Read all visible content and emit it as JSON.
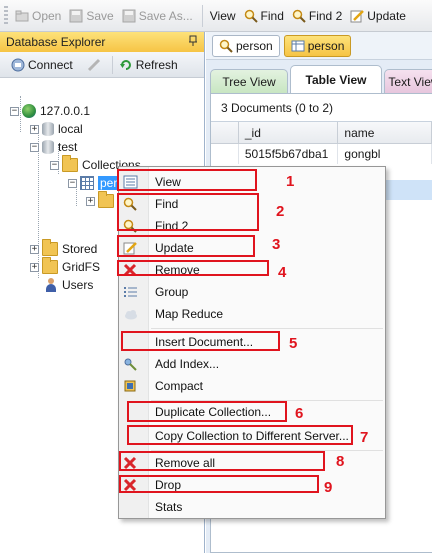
{
  "toolbar": {
    "items": [
      {
        "label": "Open",
        "icon": "open-folder-icon",
        "enabled": false
      },
      {
        "label": "Save",
        "icon": "save-icon",
        "enabled": false
      },
      {
        "label": "Save As...",
        "icon": "save-as-icon",
        "enabled": false
      },
      {
        "label": "View",
        "icon": "",
        "enabled": true
      },
      {
        "label": "Find",
        "icon": "magnifier-icon",
        "enabled": true
      },
      {
        "label": "Find 2",
        "icon": "magnifier-icon",
        "enabled": true
      },
      {
        "label": "Update",
        "icon": "edit-icon",
        "enabled": true
      }
    ]
  },
  "explorer": {
    "title": "Database Explorer",
    "pin_glyph": "ᵖ",
    "connect_label": "Connect",
    "refresh_label": "Refresh",
    "tree": {
      "server": "127.0.0.1",
      "databases": [
        "local",
        "test"
      ],
      "collections_label": "Collections",
      "selected_collection": "person",
      "stored_label": "Stored",
      "gridfs_label": "GridFS",
      "users_label": "Users"
    }
  },
  "right_pane": {
    "doc_tabs": [
      "person",
      "person"
    ],
    "view_tabs": [
      "Tree View",
      "Table View",
      "Text View"
    ],
    "active_view": "Table View",
    "count_text": "3 Documents (0 to 2)",
    "columns": [
      "_id",
      "name"
    ],
    "rows": [
      {
        "id": "5015f5b67dba1",
        "name": "gongbl"
      }
    ]
  },
  "context_menu": {
    "items": [
      {
        "label": "View",
        "icon": "list-view-icon",
        "annotation": "1"
      },
      {
        "label": "Find",
        "icon": "magnifier-icon",
        "annotation": "2"
      },
      {
        "label": "Find 2",
        "icon": "magnifier-icon",
        "annotation": "2"
      },
      {
        "label": "Update",
        "icon": "edit-icon",
        "annotation": "3"
      },
      {
        "label": "Remove",
        "icon": "red-x-icon",
        "annotation": "4"
      },
      {
        "label": "Group",
        "icon": "group-list-icon",
        "annotation": ""
      },
      {
        "label": "Map Reduce",
        "icon": "cloud-icon",
        "annotation": ""
      },
      {
        "label": "Insert Document...",
        "icon": "",
        "annotation": "5"
      },
      {
        "label": "Add Index...",
        "icon": "key-icon",
        "annotation": ""
      },
      {
        "label": "Compact",
        "icon": "compact-icon",
        "annotation": ""
      },
      {
        "label": "Duplicate Collection...",
        "icon": "",
        "annotation": "6"
      },
      {
        "label": "Copy Collection to Different Server...",
        "icon": "",
        "annotation": "7"
      },
      {
        "label": "Remove all",
        "icon": "red-x-icon",
        "annotation": "8"
      },
      {
        "label": "Drop",
        "icon": "red-x-icon",
        "annotation": "9"
      },
      {
        "label": "Stats",
        "icon": "",
        "annotation": ""
      }
    ],
    "annotations": [
      "1",
      "2",
      "3",
      "4",
      "5",
      "6",
      "7",
      "8",
      "9"
    ]
  },
  "colors": {
    "annotation_red": "#e0141e",
    "selection_blue": "#3399ff",
    "header_yellow": "#f6c445"
  }
}
